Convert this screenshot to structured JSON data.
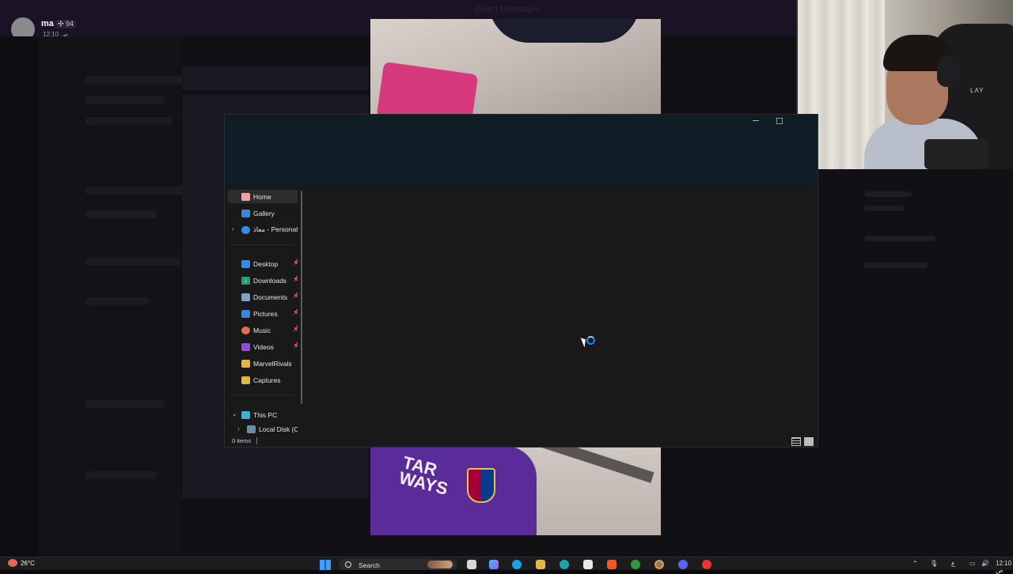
{
  "background_app": {
    "window_title": "Direct Messages",
    "user": {
      "name": "ma",
      "badge": "✣ 94",
      "subtitle": "12:10 ص"
    }
  },
  "explorer": {
    "nav": {
      "quick": [
        {
          "label": "Home",
          "icon": "home-icon",
          "active": true
        },
        {
          "label": "Gallery",
          "icon": "gallery-icon"
        },
        {
          "label": "معاذ - Personal",
          "icon": "onedrive-cloud-icon",
          "expandable": true
        }
      ],
      "pinned": [
        {
          "label": "Desktop",
          "icon": "desktop-icon",
          "pinned": true
        },
        {
          "label": "Downloads",
          "icon": "downloads-icon",
          "pinned": true
        },
        {
          "label": "Documents",
          "icon": "documents-icon",
          "pinned": true
        },
        {
          "label": "Pictures",
          "icon": "pictures-icon",
          "pinned": true
        },
        {
          "label": "Music",
          "icon": "music-icon",
          "pinned": true
        },
        {
          "label": "Videos",
          "icon": "videos-icon",
          "pinned": true
        },
        {
          "label": "MarvelRivals",
          "icon": "folder-icon"
        },
        {
          "label": "Captures",
          "icon": "folder-icon"
        }
      ],
      "this_pc": {
        "label": "This PC",
        "icon": "pc-icon",
        "expanded": true
      },
      "local_disk": {
        "label": "Local Disk (C:)",
        "icon": "drive-icon"
      }
    },
    "window_buttons": {
      "minimize": "─",
      "maximize": "☐"
    },
    "status": {
      "items_count": "0 items"
    }
  },
  "webcam": {
    "chair_label": "LAY"
  },
  "video_bottom": {
    "shirt_text": "TAR\nWAYS"
  },
  "taskbar": {
    "weather": "26°C",
    "search_label": "Search",
    "tray": {
      "lang": "ع",
      "time": "12:10 ص"
    }
  },
  "colors": {
    "accent": "#1e88ff",
    "explorer_bg": "#191919",
    "titlebar_bg": "#0f1d26",
    "discord_topbar": "#1a1326"
  }
}
